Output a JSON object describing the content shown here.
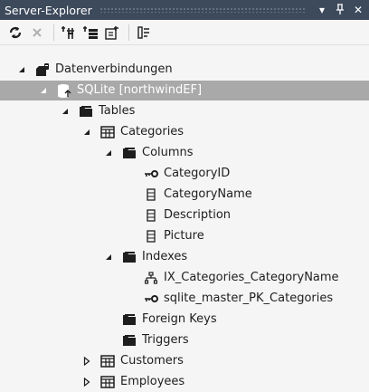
{
  "window": {
    "title": "Server-Explorer",
    "menu_glyph": "▾",
    "pin_glyph": "ᵽ",
    "close_glyph": "✕"
  },
  "toolbar": {
    "refresh_icon": "refresh-icon",
    "stop_icon": "stop-icon",
    "connect_db_icon": "connect-database-icon",
    "connect_server_icon": "connect-server-icon",
    "sql_icon": "sql-server-icon",
    "properties_icon": "properties-icon"
  },
  "tree": {
    "root": "Datenverbindungen",
    "connection": "SQLite [northwindEF]",
    "tables": "Tables",
    "categories": "Categories",
    "columns": "Columns",
    "col_category_id": "CategoryID",
    "col_category_name": "CategoryName",
    "col_description": "Description",
    "col_picture": "Picture",
    "indexes": "Indexes",
    "idx_category_name": "IX_Categories_CategoryName",
    "idx_pk": "sqlite_master_PK_Categories",
    "foreign_keys": "Foreign Keys",
    "triggers": "Triggers",
    "customers": "Customers",
    "employees": "Employees"
  },
  "colors": {
    "titlebar": "#3d4a5c",
    "selection": "#a9a9a9",
    "background": "#f5f5f5",
    "text": "#1e1e1e"
  }
}
